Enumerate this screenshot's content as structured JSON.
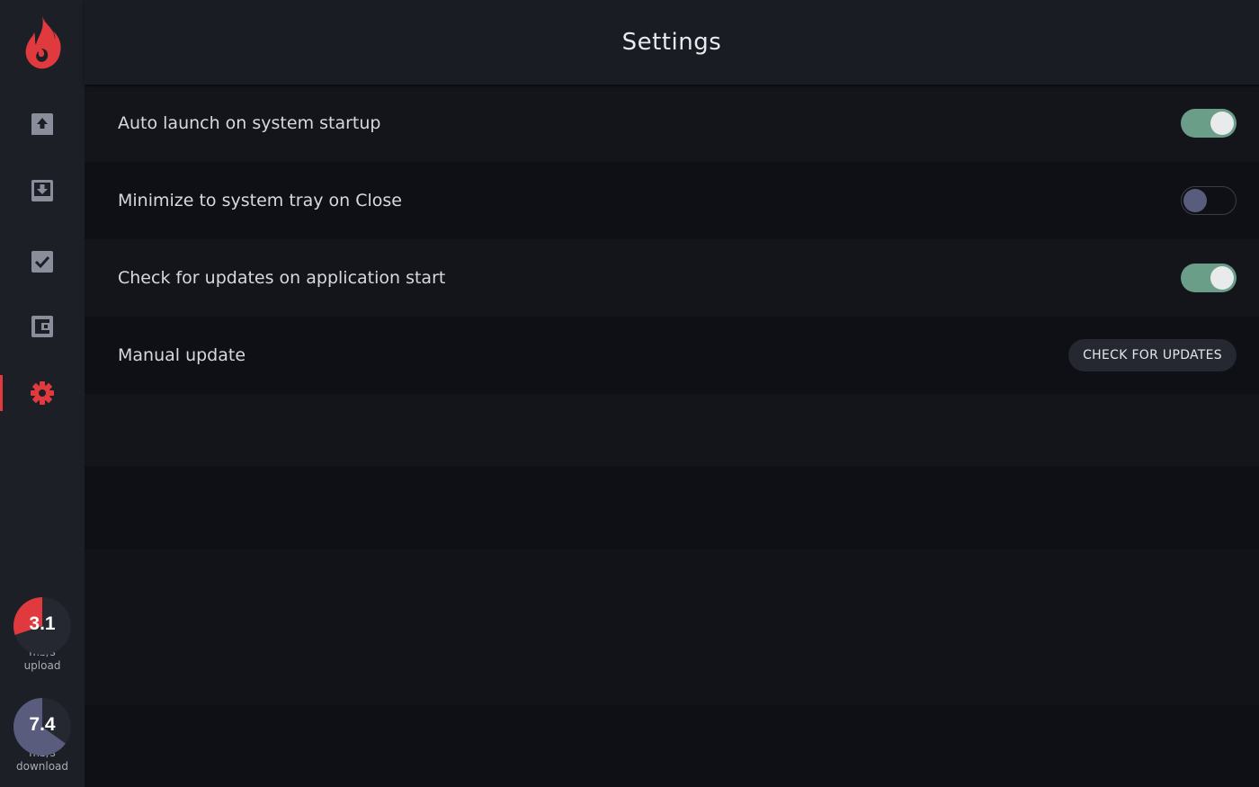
{
  "header": {
    "title": "Settings"
  },
  "sidebar": {
    "items": [
      {
        "icon": "upload-icon",
        "active": false
      },
      {
        "icon": "download-icon",
        "active": false
      },
      {
        "icon": "checkbox-icon",
        "active": false
      },
      {
        "icon": "wallet-icon",
        "active": false
      },
      {
        "icon": "gear-icon",
        "active": true
      }
    ],
    "upload_gauge": {
      "value": "3.1",
      "unit": "mb/s",
      "caption": "upload",
      "fill_fraction": 0.3,
      "color": "#e03a3e"
    },
    "download_gauge": {
      "value": "7.4",
      "unit": "mb/s",
      "caption": "download",
      "fill_fraction": 0.65,
      "color": "#5a5c7e"
    }
  },
  "settings": {
    "auto_launch": {
      "label": "Auto launch on system startup",
      "enabled": true
    },
    "minimize_tray": {
      "label": "Minimize to system tray on Close",
      "enabled": false
    },
    "check_updates": {
      "label": "Check for updates on application start",
      "enabled": true
    },
    "manual_update": {
      "label": "Manual update",
      "button_label": "CHECK FOR UPDATES"
    }
  },
  "colors": {
    "accent": "#e03a3e",
    "toggle_on": "#6a9e88",
    "toggle_off_knob": "#5a5c7e",
    "sidebar_bg": "#1d1f27",
    "icon_gray": "#8a8e9a"
  }
}
